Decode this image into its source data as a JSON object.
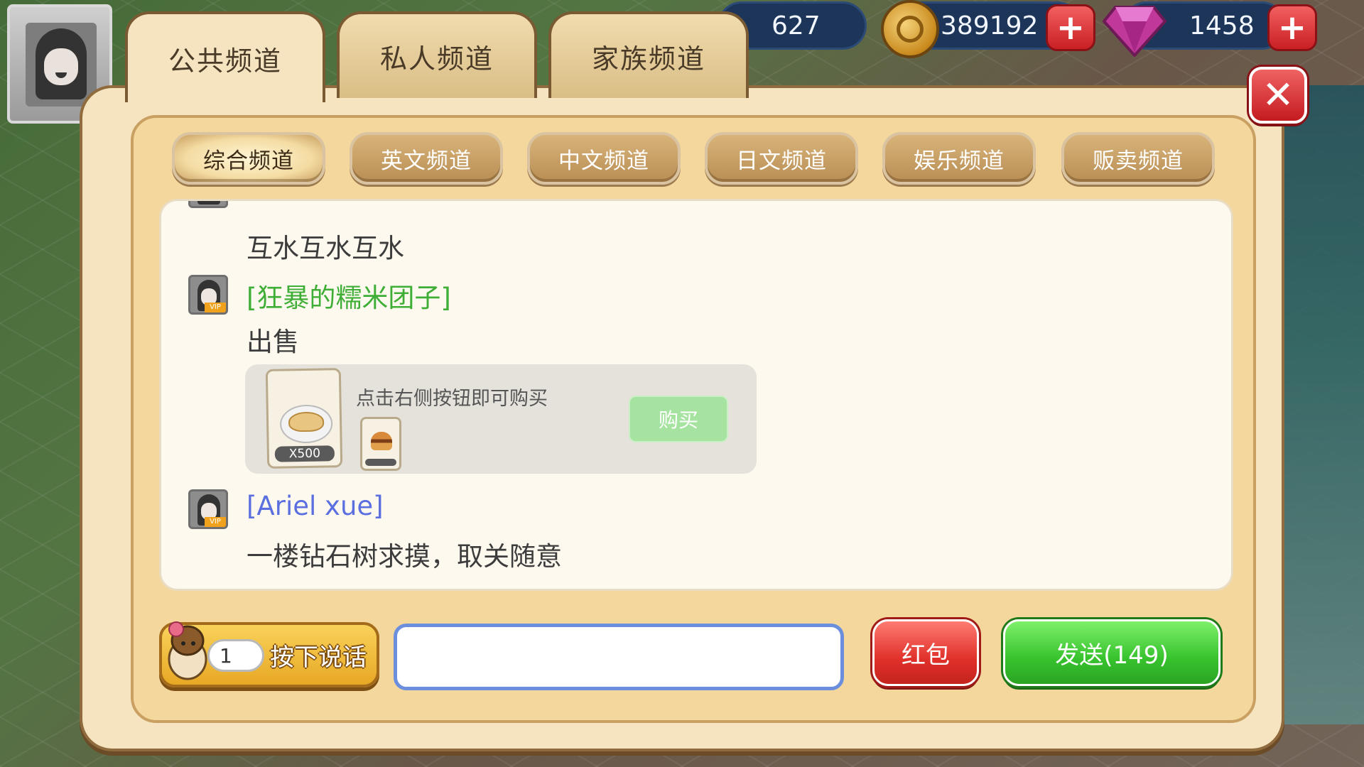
{
  "hud": {
    "energy_value": "627",
    "coins_value": "389192",
    "gems_value": "1458",
    "plus_symbol": "+"
  },
  "tabs": [
    {
      "label": "公共频道",
      "active": true
    },
    {
      "label": "私人频道",
      "active": false
    },
    {
      "label": "家族频道",
      "active": false
    }
  ],
  "subtabs": [
    {
      "label": "综合频道",
      "active": true
    },
    {
      "label": "英文频道",
      "active": false
    },
    {
      "label": "中文频道",
      "active": false
    },
    {
      "label": "日文频道",
      "active": false
    },
    {
      "label": "娱乐频道",
      "active": false
    },
    {
      "label": "贩卖频道",
      "active": false
    }
  ],
  "close_symbol": "✕",
  "messages": [
    {
      "text": "互水互水互水"
    },
    {
      "username": "[狂暴的糯米团子]",
      "username_color": "#3fae36",
      "text": "出售",
      "sale": {
        "hint": "点击右侧按钮即可购买",
        "item_qty": "X500",
        "buy_label": "购买"
      }
    },
    {
      "username": "[Ariel xue]",
      "username_color": "#5b6fe0",
      "text": "一楼钻石树求摸，取关随意"
    }
  ],
  "vip_label": "VIP",
  "bottom": {
    "voice_count": "1",
    "voice_label": "按下说话",
    "input_value": "",
    "red_packet_label": "红包",
    "send_label": "发送(149)"
  },
  "colors": {
    "accent_green": "#37c22d",
    "accent_red": "#e0312a",
    "panel_bg": "#f5e4bf"
  }
}
